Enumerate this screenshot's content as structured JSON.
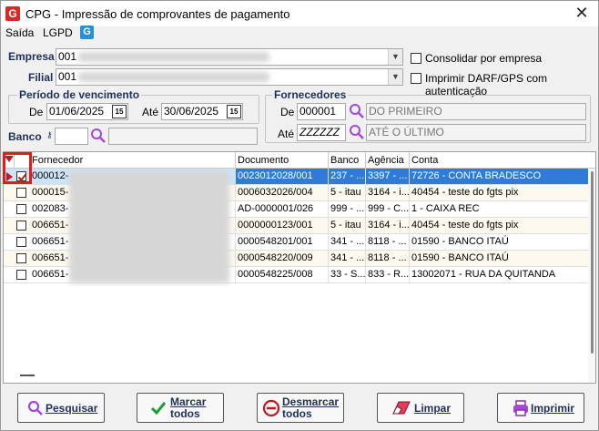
{
  "window": {
    "title": "CPG - Impressão de comprovantes de pagamento",
    "close": "✕"
  },
  "menu": {
    "items": [
      "Saída",
      "LGPD"
    ],
    "lgpd_icon": "G"
  },
  "empresa": {
    "label": "Empresa",
    "value": "001"
  },
  "filial": {
    "label": "Filial",
    "value": "001"
  },
  "options": {
    "consolidar": "Consolidar por empresa",
    "imprimir_darf": "Imprimir DARF/GPS com autenticação"
  },
  "periodo": {
    "title": "Período de vencimento",
    "de_label": "De",
    "de_value": "01/06/2025",
    "ate_label": "Até",
    "ate_value": "30/06/2025",
    "cal_icon": "15"
  },
  "banco": {
    "label": "Banco",
    "value": ""
  },
  "fornecedores": {
    "title": "Fornecedores",
    "de_label": "De",
    "de_code": "000001",
    "de_name": "DO PRIMEIRO",
    "ate_label": "Até",
    "ate_code": "ZZZZZZ",
    "ate_name": "ATÉ O ÚLTIMO"
  },
  "grid": {
    "columns": [
      "Fornecedor",
      "Documento",
      "Banco",
      "Agência",
      "Conta"
    ],
    "rows": [
      {
        "checked": true,
        "fornecedor": "000012-",
        "documento": "0023012028/001",
        "banco": "237 - ...",
        "agencia": "3397 - ...",
        "conta": "72726 - CONTA BRADESCO"
      },
      {
        "checked": false,
        "fornecedor": "000015-",
        "documento": "0006032026/004",
        "banco": "5 - itau",
        "agencia": "3164 - i...",
        "conta": "40454 - teste do fgts pix"
      },
      {
        "checked": false,
        "fornecedor": "002083-",
        "documento": "AD-0000001/026",
        "banco": "999 - ...",
        "agencia": "999 - C...",
        "conta": "1 - CAIXA REC"
      },
      {
        "checked": false,
        "fornecedor": "006651-",
        "documento": "0000000123/001",
        "banco": "5 - itau",
        "agencia": "3164 - i...",
        "conta": "40454 - teste do fgts pix"
      },
      {
        "checked": false,
        "fornecedor": "006651-",
        "documento": "0000548201/001",
        "banco": "341 - ...",
        "agencia": "8118 - ...",
        "conta": "01590 - BANCO ITAÚ"
      },
      {
        "checked": false,
        "fornecedor": "006651-",
        "documento": "0000548220/009",
        "banco": "341 - ...",
        "agencia": "8118 - ...",
        "conta": "01590 - BANCO ITAÚ"
      },
      {
        "checked": false,
        "fornecedor": "006651-",
        "documento": "0000548225/008",
        "banco": "33 - S...",
        "agencia": "833 - R...",
        "conta": "13002071 - RUA DA QUITANDA"
      }
    ]
  },
  "buttons": {
    "pesquisar": "Pesquisar",
    "marcar_1": "Marcar",
    "marcar_2": "todos",
    "desmarcar_1": "Desmarcar",
    "desmarcar_2": "todos",
    "limpar": "Limpar",
    "imprimir": "Imprimir"
  },
  "colors": {
    "accent": "#2f7bd6",
    "highlight": "#e31b1b",
    "label": "#1f2f5a"
  }
}
